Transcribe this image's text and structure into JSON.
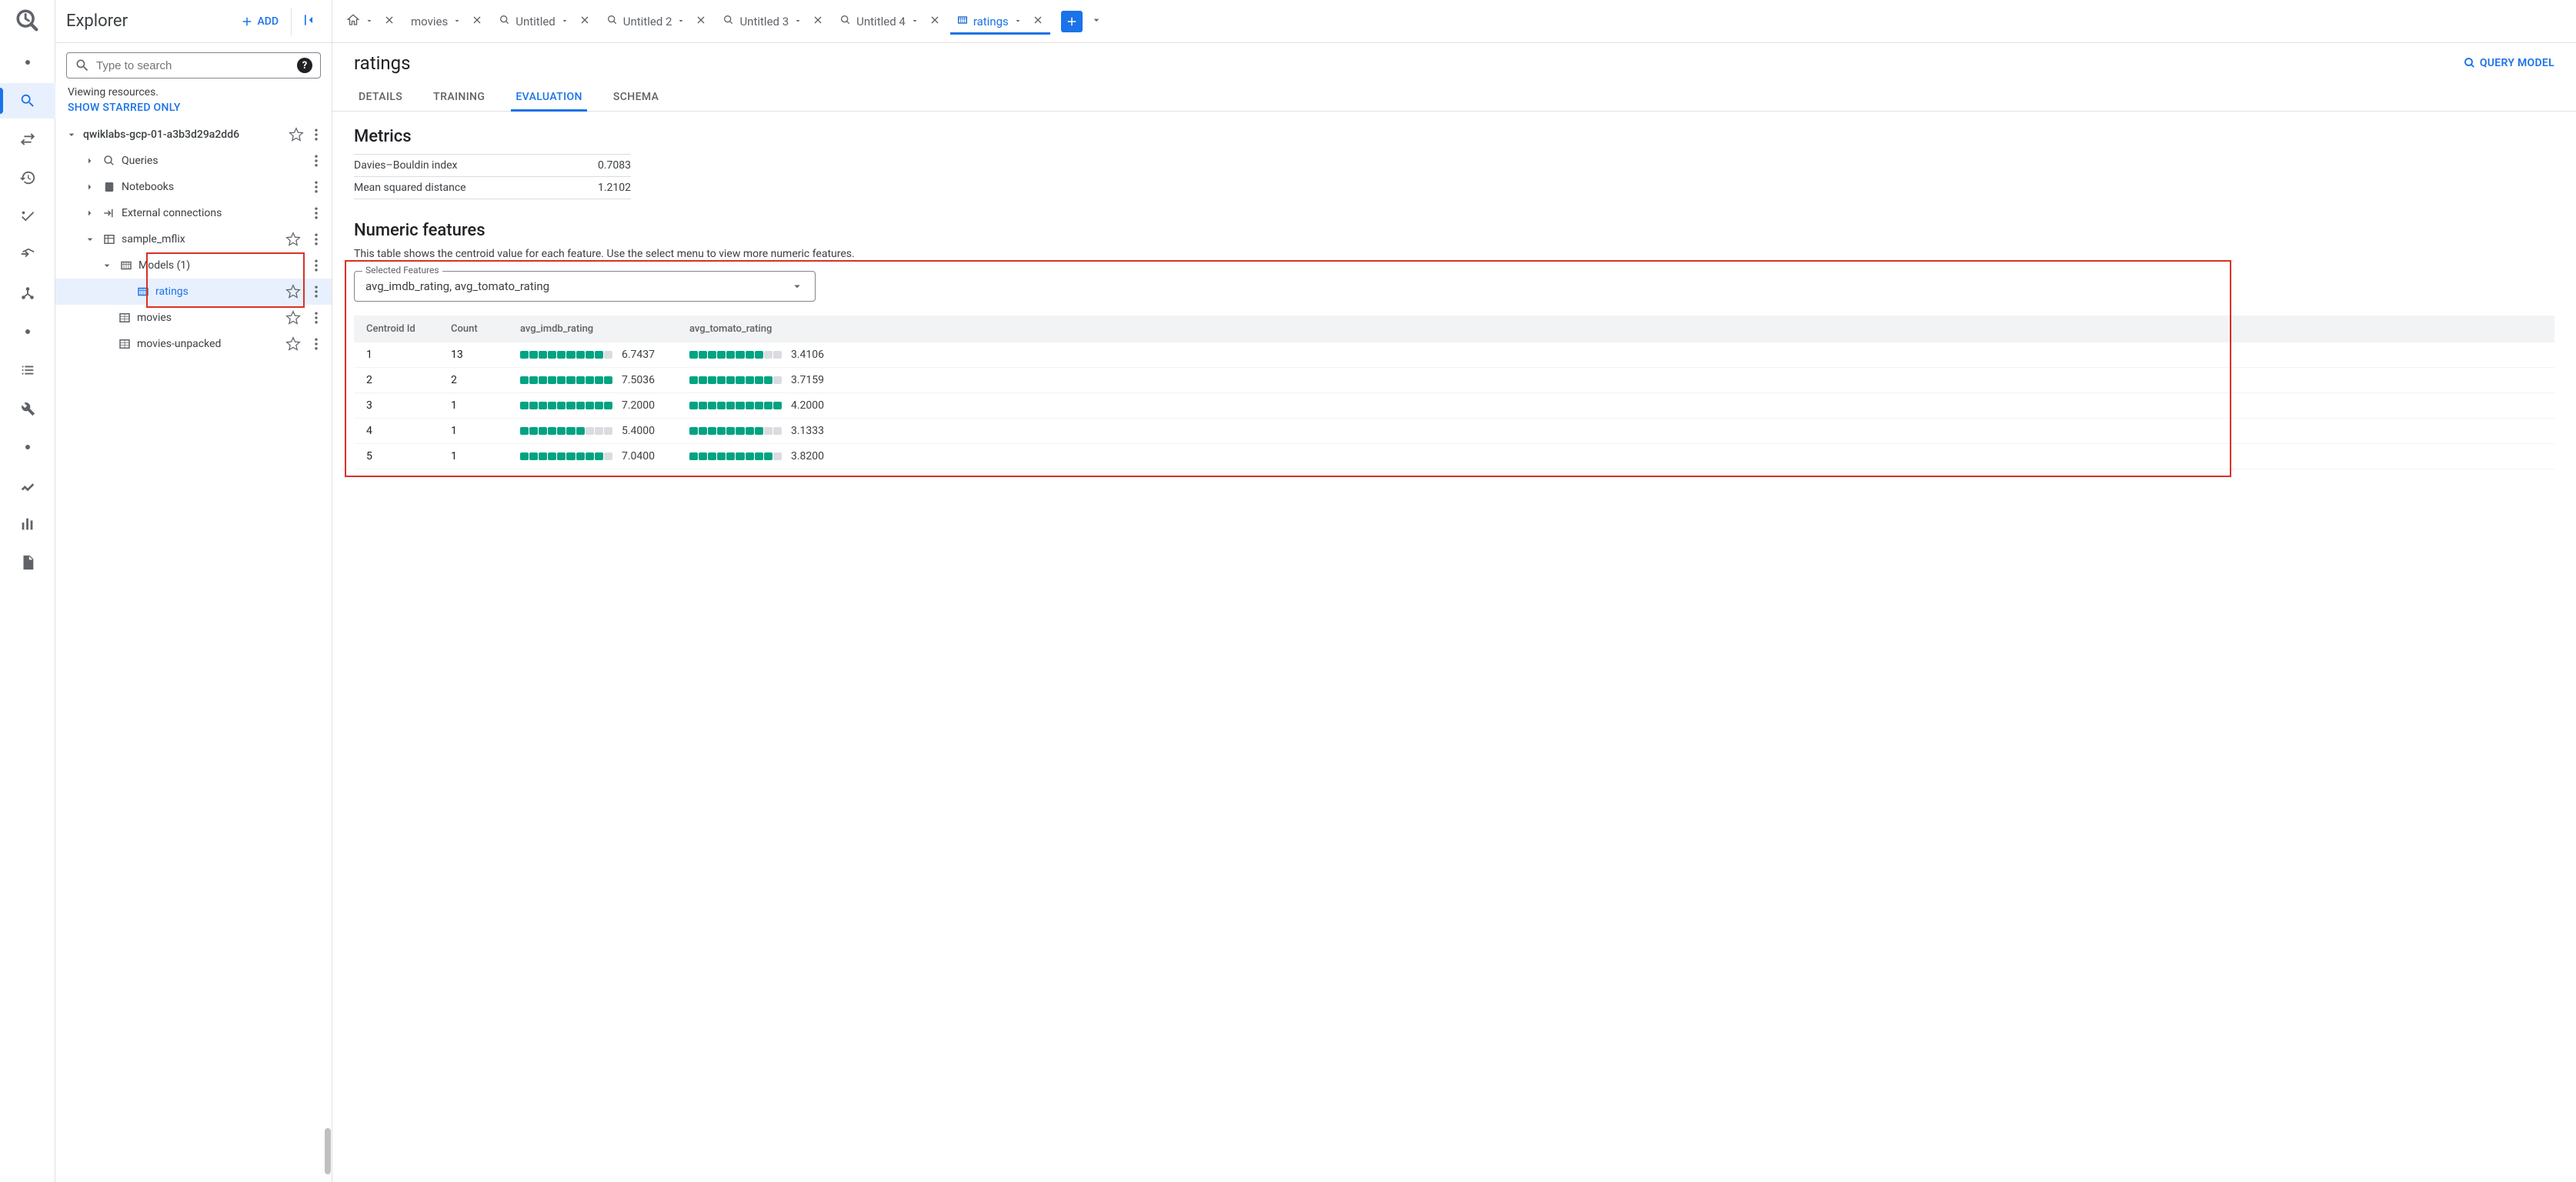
{
  "explorer": {
    "title": "Explorer",
    "add_label": "ADD",
    "search_placeholder": "Type to search",
    "viewing_text": "Viewing resources.",
    "starred_only": "SHOW STARRED ONLY",
    "project": "qwiklabs-gcp-01-a3b3d29a2dd6",
    "nodes": {
      "queries": "Queries",
      "notebooks": "Notebooks",
      "external": "External connections",
      "dataset": "sample_mflix",
      "models": "Models (1)",
      "ratings": "ratings",
      "movies": "movies",
      "movies_unpacked": "movies-unpacked"
    }
  },
  "tabs": {
    "t1": "movies",
    "t2": "Untitled",
    "t3": "Untitled 2",
    "t4": "Untitled 3",
    "t5": "Untitled 4",
    "t6": "ratings"
  },
  "doc": {
    "title": "ratings",
    "query_model": "QUERY MODEL",
    "subtabs": {
      "details": "DETAILS",
      "training": "TRAINING",
      "evaluation": "EVALUATION",
      "schema": "SCHEMA"
    }
  },
  "metrics": {
    "heading": "Metrics",
    "rows": [
      {
        "name": "Davies–Bouldin index",
        "value": "0.7083"
      },
      {
        "name": "Mean squared distance",
        "value": "1.2102"
      }
    ]
  },
  "numeric": {
    "heading": "Numeric features",
    "desc": "This table shows the centroid value for each feature. Use the select menu to view more numeric features.",
    "select_label": "Selected Features",
    "select_value": "avg_imdb_rating, avg_tomato_rating",
    "headers": {
      "cid": "Centroid Id",
      "count": "Count",
      "f1": "avg_imdb_rating",
      "f2": "avg_tomato_rating"
    }
  },
  "chart_data": {
    "type": "table",
    "columns": [
      "Centroid Id",
      "Count",
      "avg_imdb_rating",
      "avg_tomato_rating"
    ],
    "rows": [
      {
        "cid": "1",
        "count": "13",
        "f1": "6.7437",
        "f1_fill": 9,
        "f2": "3.4106",
        "f2_fill": 8
      },
      {
        "cid": "2",
        "count": "2",
        "f1": "7.5036",
        "f1_fill": 10,
        "f2": "3.7159",
        "f2_fill": 9
      },
      {
        "cid": "3",
        "count": "1",
        "f1": "7.2000",
        "f1_fill": 10,
        "f2": "4.2000",
        "f2_fill": 10
      },
      {
        "cid": "4",
        "count": "1",
        "f1": "5.4000",
        "f1_fill": 7,
        "f2": "3.1333",
        "f2_fill": 8
      },
      {
        "cid": "5",
        "count": "1",
        "f1": "7.0400",
        "f1_fill": 9,
        "f2": "3.8200",
        "f2_fill": 9
      }
    ]
  }
}
